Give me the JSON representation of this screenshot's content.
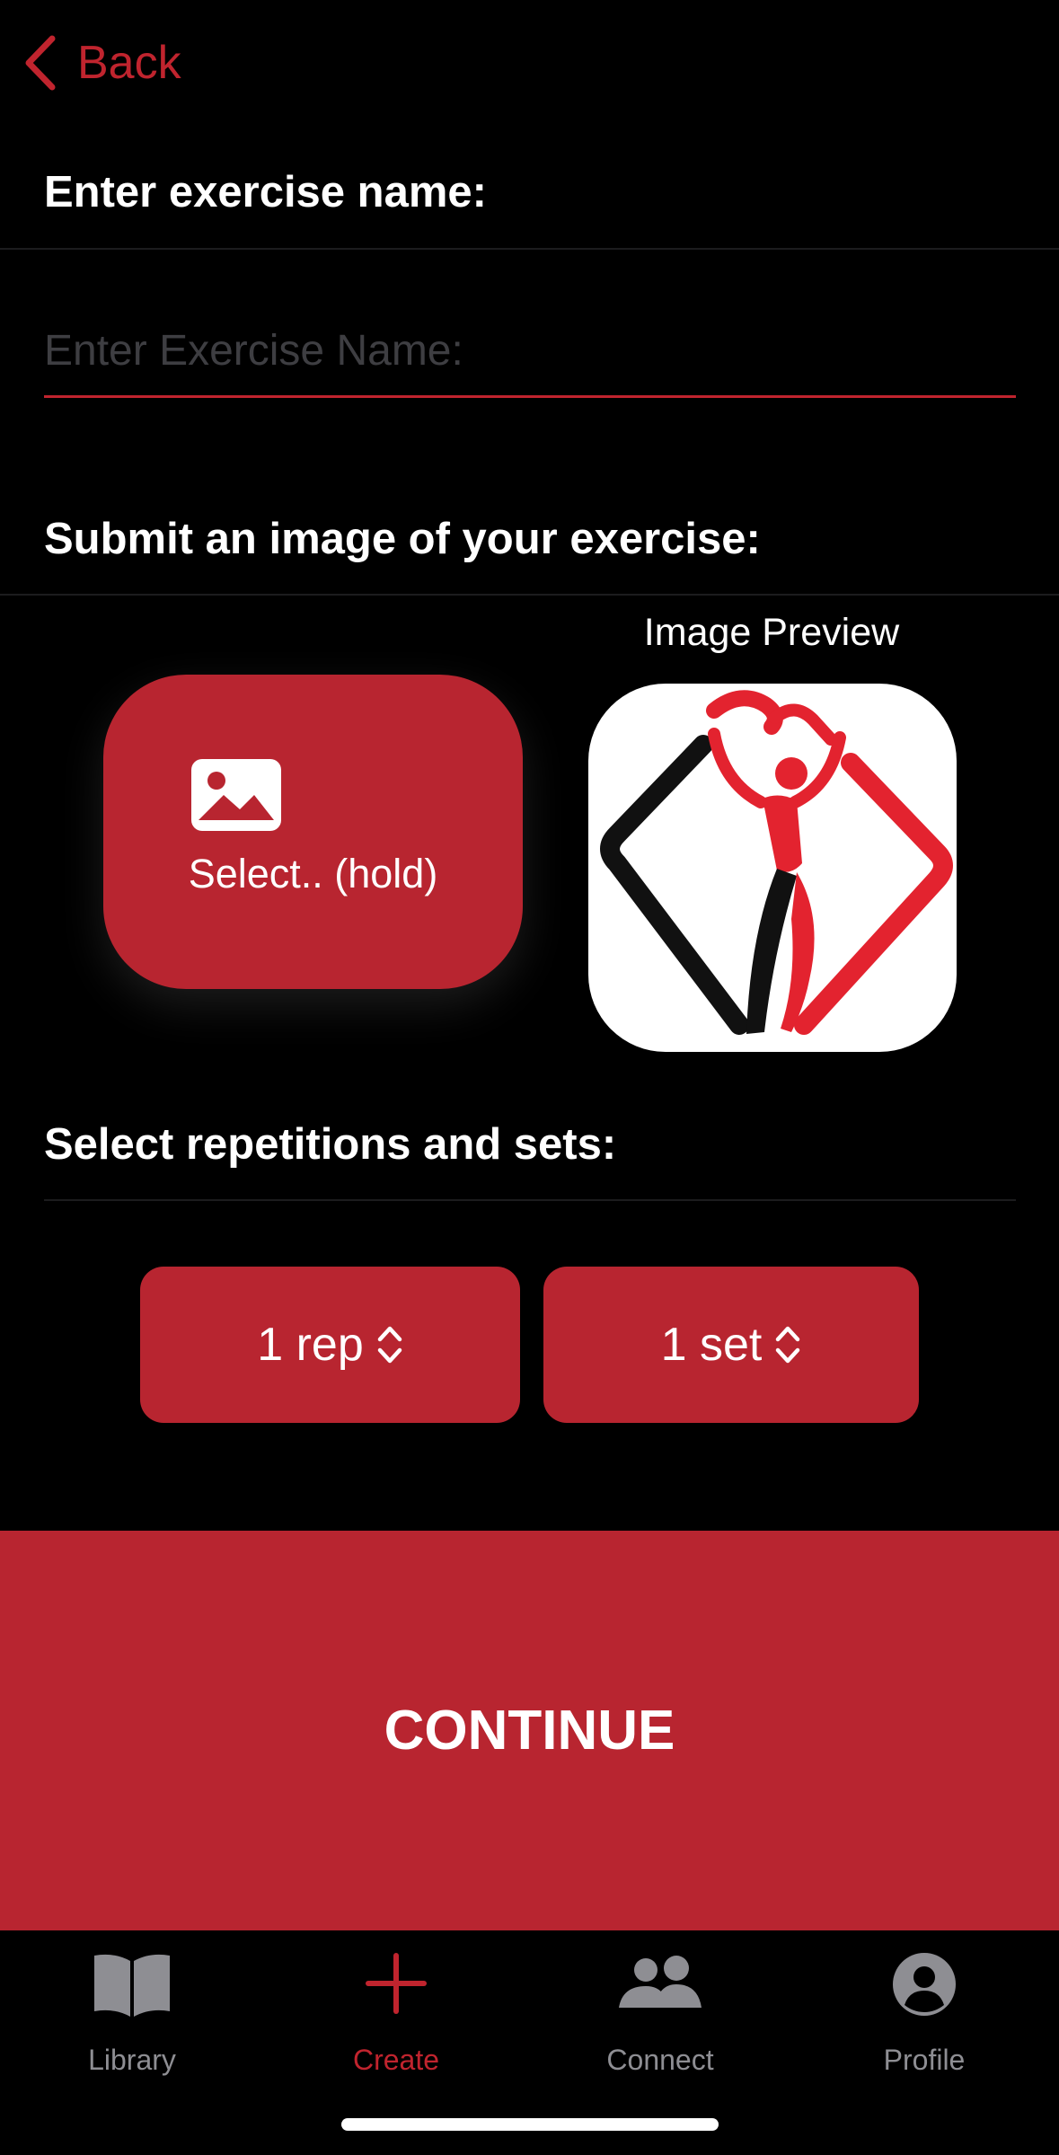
{
  "nav": {
    "back_label": "Back"
  },
  "sections": {
    "name_title": "Enter exercise name:",
    "image_title": "Submit an image of your exercise:",
    "reps_title": "Select repetitions and sets:"
  },
  "name_input": {
    "placeholder": "Enter Exercise Name:",
    "value": ""
  },
  "image": {
    "select_label": "Select.. (hold)",
    "select_icon": "photo-icon",
    "preview_title": "Image Preview",
    "preview_logo": "dancer-logo"
  },
  "pickers": {
    "reps": {
      "selected": "1 rep",
      "icon": "up-down-chevron-icon"
    },
    "sets": {
      "selected": "1 set",
      "icon": "up-down-chevron-icon"
    }
  },
  "continue_label": "CONTINUE",
  "tabbar": {
    "items": [
      {
        "label": "Library",
        "icon": "book-icon",
        "active": false
      },
      {
        "label": "Create",
        "icon": "plus-icon",
        "active": true
      },
      {
        "label": "Connect",
        "icon": "people-icon",
        "active": false
      },
      {
        "label": "Profile",
        "icon": "person-circle-icon",
        "active": false
      }
    ]
  },
  "colors": {
    "accent": "#c0242e",
    "button_fill": "#b82530",
    "background": "#000000",
    "inactive_tab": "#8e8e93",
    "placeholder": "#3e3e42"
  }
}
